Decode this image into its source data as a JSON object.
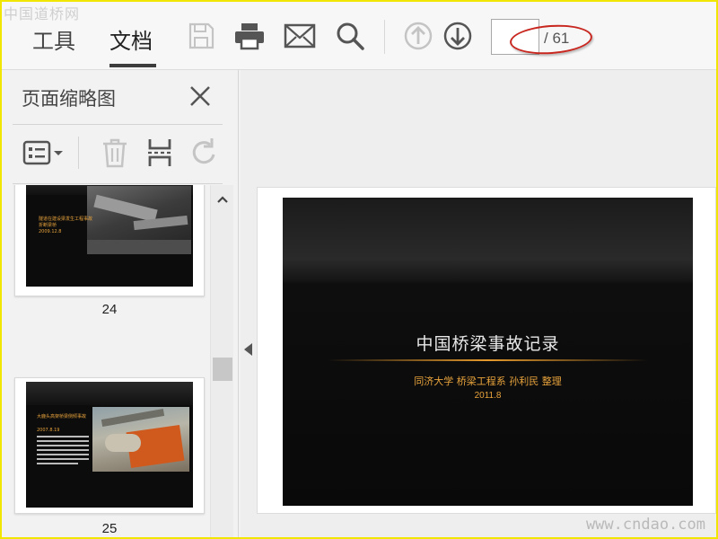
{
  "watermarks": {
    "top": "中国道桥网",
    "bottom": "www.cndao.com"
  },
  "toolbar": {
    "tabs": [
      {
        "label": "工具",
        "active": false
      },
      {
        "label": "文档",
        "active": true
      }
    ],
    "icons": [
      "save-icon",
      "print-icon",
      "mail-icon",
      "search-icon",
      "page-up-icon",
      "page-down-icon"
    ],
    "page_input_value": "",
    "page_total": "/ 61"
  },
  "side_panel": {
    "title": "页面缩略图",
    "tools": [
      "thumbnail-options-icon",
      "delete-icon",
      "extract-icon",
      "rotate-icon"
    ],
    "thumbnails": [
      {
        "page": "24",
        "text_lines": [
          "隧道在建设梁发生工程事故",
          "折断梁桥",
          "2009.12.8"
        ]
      },
      {
        "page": "25",
        "text_lines": [
          "大鹿头高架桥梁侧倾事故",
          "2007.8.19"
        ]
      }
    ]
  },
  "document": {
    "slide_title": "中国桥梁事故记录",
    "slide_subtitle": "同济大学 桥梁工程系 孙利民 整理",
    "slide_date": "2011.8"
  },
  "colors": {
    "accent_orange": "#e8a33c",
    "annotation_red": "#c8271f",
    "frame_yellow": "#f0e600"
  }
}
